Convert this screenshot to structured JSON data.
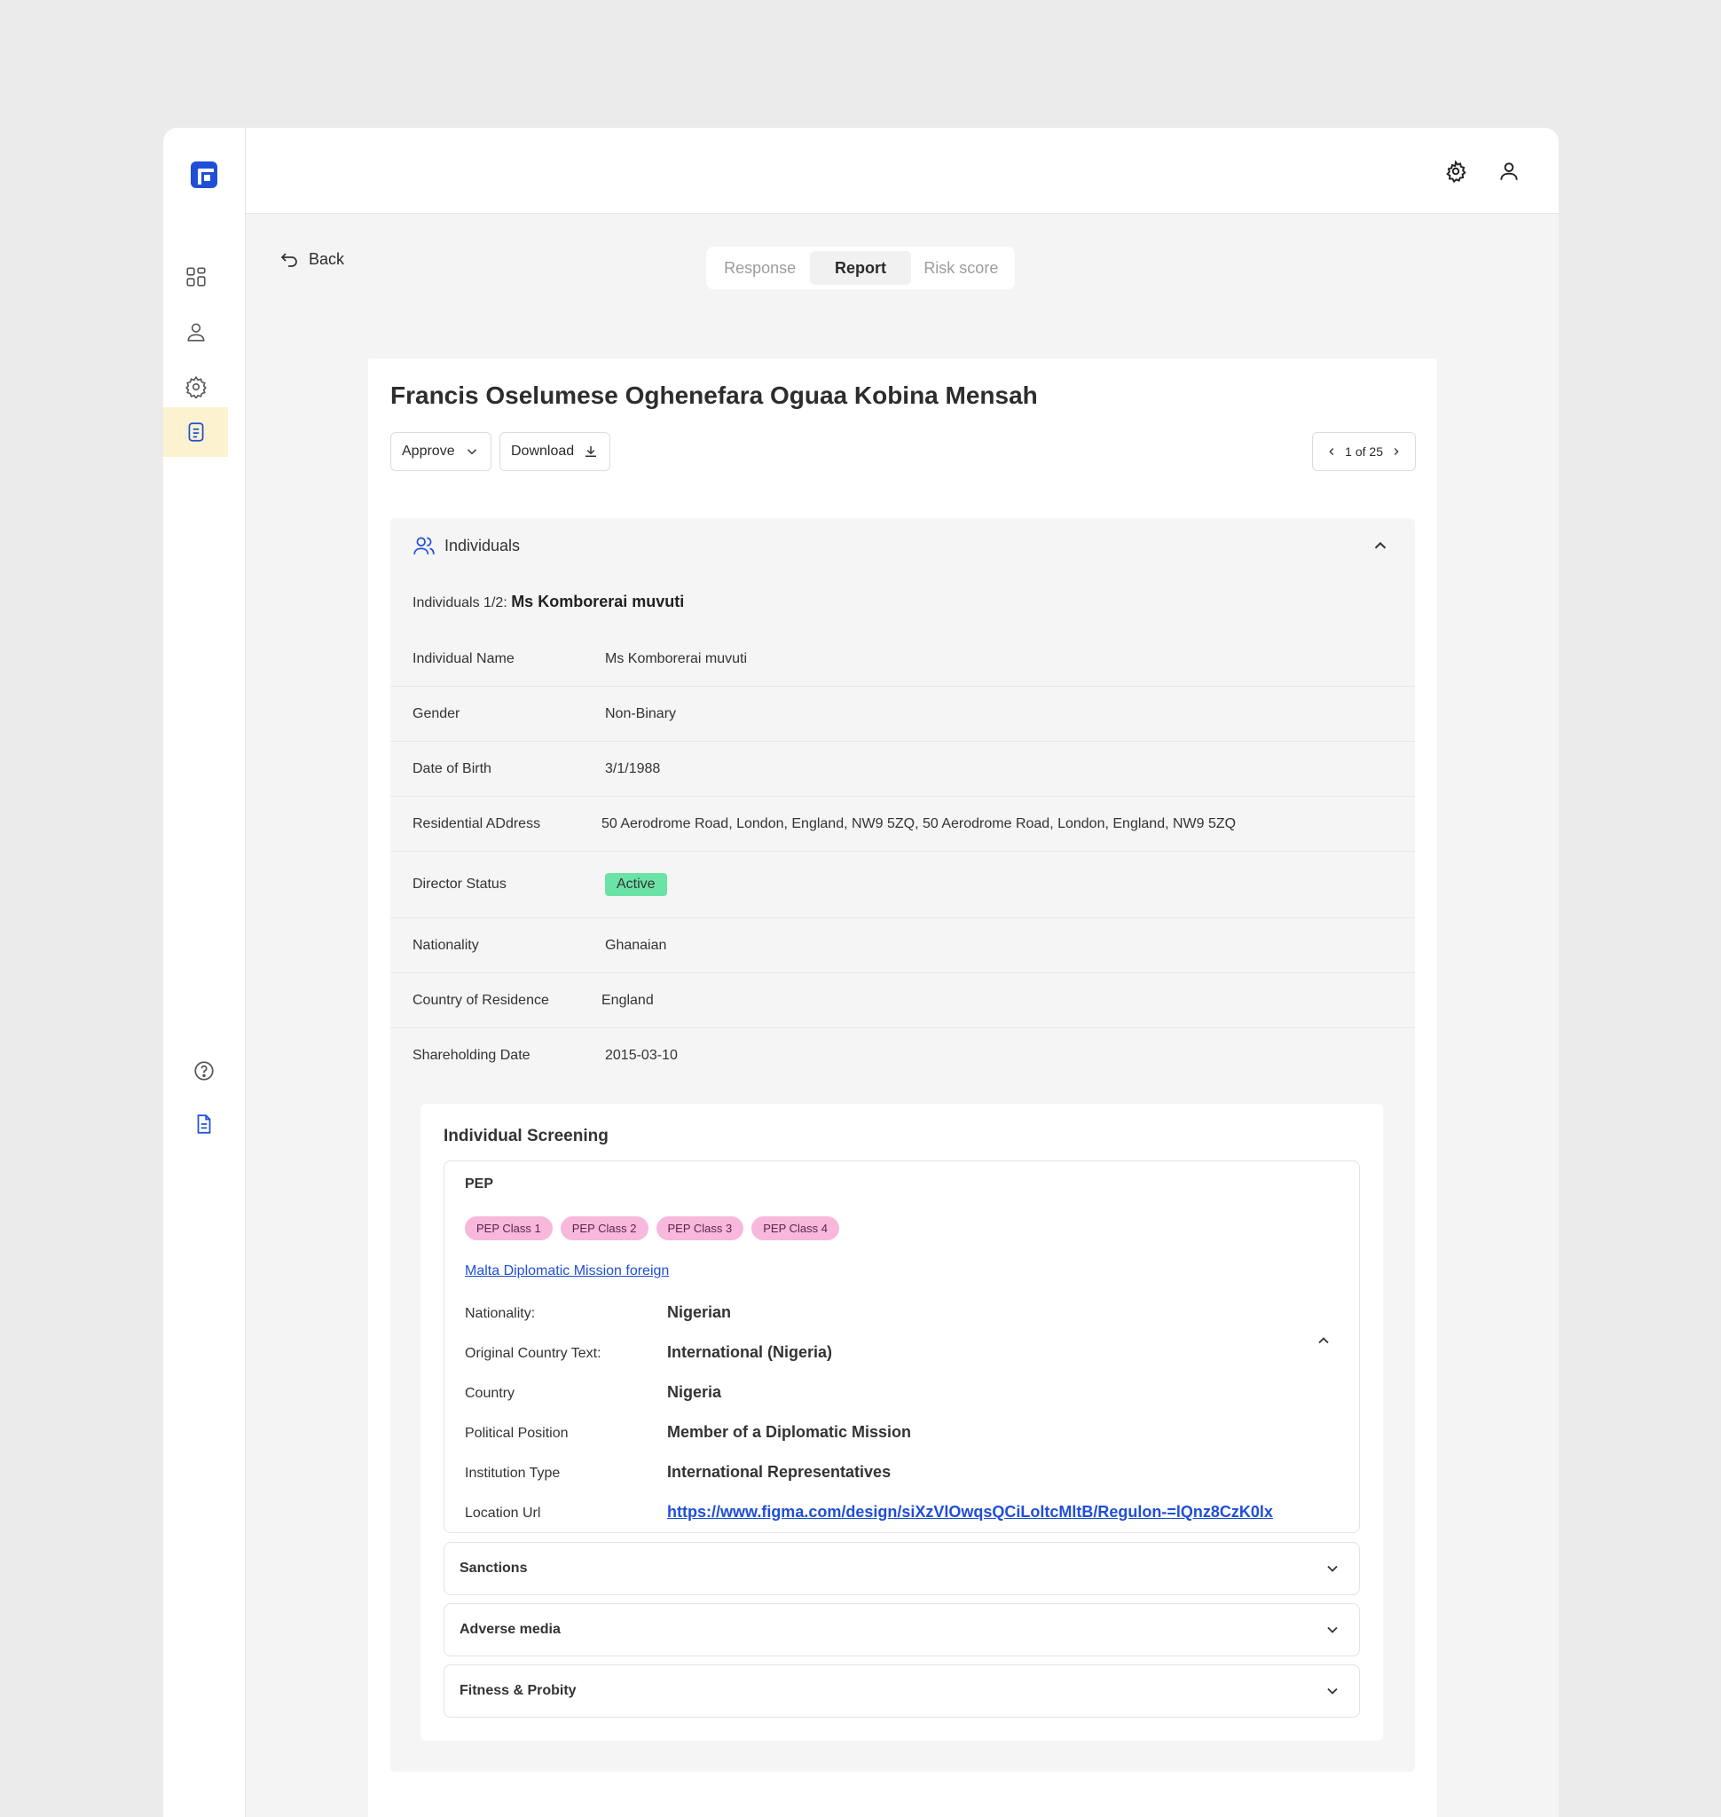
{
  "topbar": {
    "settings_icon": "gear-icon",
    "profile_icon": "user-icon"
  },
  "sidebar": {
    "items": [
      {
        "icon": "dashboard-icon"
      },
      {
        "icon": "user-icon"
      },
      {
        "icon": "settings-cog-icon"
      },
      {
        "icon": "report-icon",
        "active": true
      }
    ],
    "bottom": [
      {
        "icon": "help-icon"
      },
      {
        "icon": "document-icon"
      }
    ]
  },
  "nav": {
    "back_label": "Back"
  },
  "tabs": [
    {
      "label": "Response"
    },
    {
      "label": "Report",
      "active": true
    },
    {
      "label": "Risk score"
    }
  ],
  "report": {
    "title": "Francis Oselumese Oghenefara Oguaa Kobina Mensah",
    "approve_label": "Approve",
    "download_label": "Download",
    "pager": "1 of 25"
  },
  "individuals": {
    "section_title": "Individuals",
    "sub_prefix": "Individuals 1/2: ",
    "sub_name": "Ms Komborerai muvuti",
    "fields": [
      {
        "label": "Individual Name",
        "value": "Ms Komborerai muvuti"
      },
      {
        "label": "Gender",
        "value": "Non-Binary"
      },
      {
        "label": "Date of Birth",
        "value": "3/1/1988"
      },
      {
        "label": "Residential ADdress",
        "value": "50 Aerodrome Road, London, England, NW9 5ZQ, 50 Aerodrome Road, London, England, NW9 5ZQ"
      },
      {
        "label": "Director Status",
        "value": "Active"
      },
      {
        "label": "Nationality",
        "value": "Ghanaian"
      },
      {
        "label": "Country of Residence",
        "value": "England"
      },
      {
        "label": "Shareholding Date",
        "value": "2015-03-10"
      }
    ]
  },
  "screening": {
    "title": "Individual Screening",
    "pep": {
      "title": "PEP",
      "chips": [
        "PEP Class 1",
        "PEP Class 2",
        "PEP Class 3",
        "PEP Class 4"
      ],
      "link": "Malta Diplomatic Mission foreign",
      "details": [
        {
          "label": "Nationality:",
          "value": "Nigerian"
        },
        {
          "label": "Original Country Text:",
          "value": "International  (Nigeria)"
        },
        {
          "label": "Country",
          "value": "Nigeria"
        },
        {
          "label": "Political Position",
          "value": "Member of a Diplomatic Mission"
        },
        {
          "label": "Institution Type",
          "value": "International Representatives"
        },
        {
          "label": "Location Url",
          "value": "https://www.figma.com/design/siXzVlOwqsQCiLoltcMltB/Regulon-=lQnz8CzK0lx"
        }
      ]
    },
    "accordions": [
      {
        "label": "Sanctions"
      },
      {
        "label": "Adverse media"
      },
      {
        "label": "Fitness & Probity"
      }
    ]
  },
  "colors": {
    "brand": "#1f4fd8",
    "active_badge": "#6be3a6",
    "pep_chip": "#f7b8dc",
    "sidebar_active": "#fdf2cf"
  }
}
